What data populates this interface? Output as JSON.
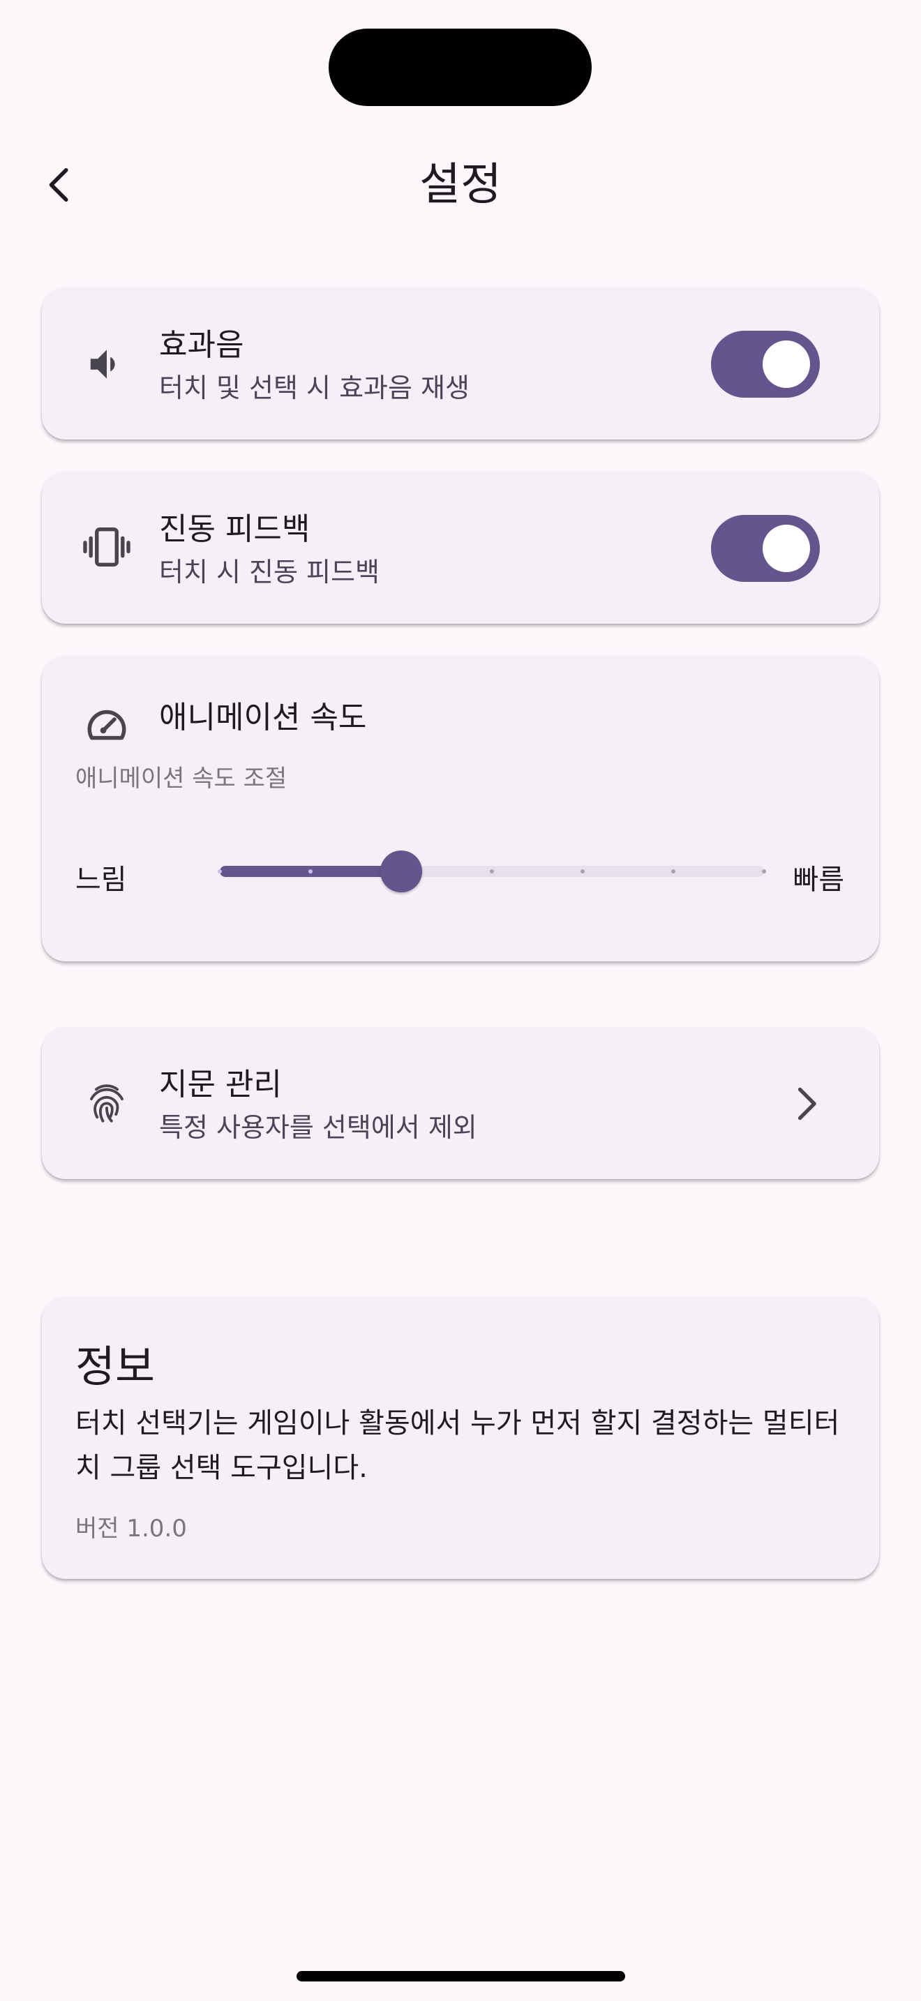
{
  "header": {
    "title": "설정",
    "back_icon": "chevron-left-icon"
  },
  "settings": {
    "sound": {
      "icon": "speaker-icon",
      "title": "효과음",
      "subtitle": "터치 및 선택 시 효과음 재생",
      "enabled": true
    },
    "vibration": {
      "icon": "vibration-icon",
      "title": "진동 피드백",
      "subtitle": "터치 시 진동 피드백",
      "enabled": true
    },
    "animation": {
      "icon": "speedometer-icon",
      "title": "애니메이션 속도",
      "subtitle": "애니메이션 속도 조절",
      "min_label": "느림",
      "max_label": "빠름",
      "steps": 7,
      "value_index": 2
    },
    "fingerprint": {
      "icon": "fingerprint-icon",
      "title": "지문 관리",
      "subtitle": "특정 사용자를 선택에서 제외",
      "chevron": "chevron-right-icon"
    }
  },
  "info": {
    "title": "정보",
    "description": "터치 선택기는 게임이나 활동에서 누가 먼저 할지 결정하는 멀티터치 그룹 선택 도구입니다.",
    "version": "버전 1.0.0"
  },
  "colors": {
    "accent": "#65558f",
    "background": "#fdf7fc",
    "card": "#f5eff7",
    "track": "#e7e0eb"
  }
}
